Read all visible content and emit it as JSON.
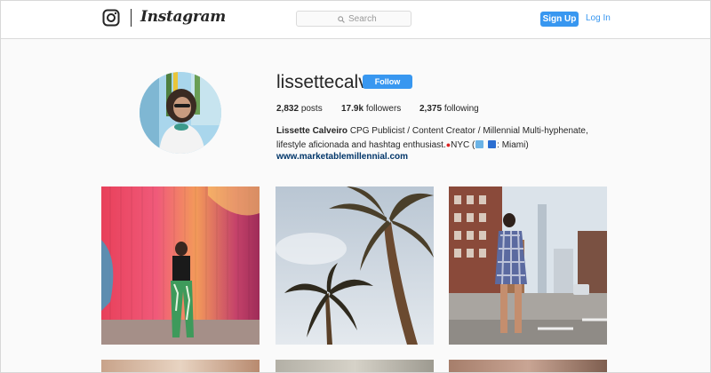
{
  "app": {
    "brand": "Instagram",
    "accent_color": "#3897f0",
    "link_color": "#003569"
  },
  "header": {
    "logo_icon": "camera-glyph-icon",
    "search_placeholder": "Search",
    "search_icon": "magnifier-icon",
    "signup_label": "Sign Up",
    "login_label": "Log In"
  },
  "profile": {
    "username": "lissettecalv",
    "follow_label": "Follow",
    "posts_count": "2,832",
    "posts_label": "posts",
    "followers_count": "17.9k",
    "followers_label": "followers",
    "following_count": "2,375",
    "following_label": "following",
    "full_name": "Lissette Calveiro",
    "bio_part1": "CPG Publicist / Content Creator / Millennial Multi-hyphenate, lifestyle aficionada and hashtag enthusiast.",
    "bio_part2": "NYC (",
    "bio_part3": ": Miami)",
    "website": "www.marketablemillennial.com"
  },
  "posts": [
    {
      "subject": "woman posing in front of colorful painted wall"
    },
    {
      "subject": "palm trees against sky"
    },
    {
      "subject": "woman in gingham dress on city street"
    }
  ]
}
